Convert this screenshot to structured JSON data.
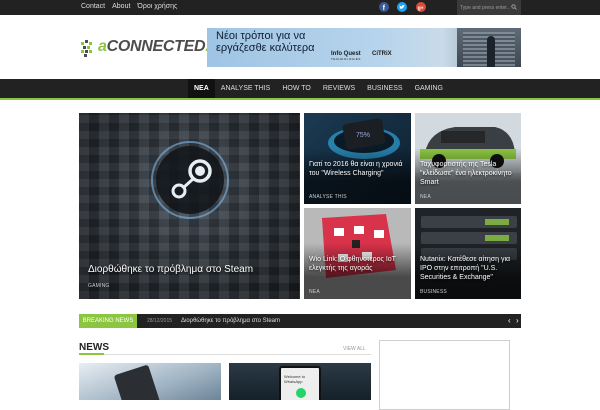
{
  "topbar": {
    "links": [
      "Contact",
      "About",
      "Όροι χρήσης"
    ],
    "social": [
      "facebook-icon",
      "twitter-icon",
      "google-plus-icon"
    ],
    "search_placeholder": "Type and press enter..."
  },
  "logo": {
    "prefix": "a",
    "text": "CONNECTED",
    "dot": "."
  },
  "banner": {
    "headline_1": "Νέοι τρόποι για να",
    "headline_2": "εργάζεσθε καλύτερα",
    "brand_1": "Info Quest",
    "brand_1_sub": "TECHNOLOGIES",
    "brand_2": "CiTRiX"
  },
  "nav": {
    "items": [
      "ΝΕΑ",
      "ANALYSE THIS",
      "HOW TO",
      "REVIEWS",
      "BUSINESS",
      "GAMING"
    ]
  },
  "featured": {
    "main": {
      "title": "Διορθώθηκε το πρόβλημα στο Steam",
      "category": "GAMING"
    },
    "items": [
      {
        "title": "Γιατί το 2016 θα είναι η χρονιά του \"Wireless Charging\"",
        "category": "ANALYSE THIS"
      },
      {
        "title": "Ταχυφορτιστής της Tesla \"κλείδωσε\" ένα ηλεκτροκίνητο Smart",
        "category": "ΝΕΑ"
      },
      {
        "title": "Wio Link: Ο φθηνότερος IoT ελεγκτής της αγοράς",
        "category": "ΝΕΑ"
      },
      {
        "title": "Nutanix: Κατέθεσε αίτηση για IPO στην επιτροπή \"U.S. Securities & Exchange\"",
        "category": "BUSINESS"
      }
    ]
  },
  "breaking": {
    "label": "BREAKING NEWS",
    "date": "28/12/2015",
    "text": "Διορθώθηκε το πρόβλημα στο Steam",
    "prev": "‹",
    "next": "›"
  },
  "news": {
    "title": "NEWS",
    "view_all": "VIEW ALL",
    "thumb2_text": "Welcome to WhatsApp"
  },
  "colors": {
    "accent": "#8cc641",
    "dark_bar": "#222222"
  }
}
